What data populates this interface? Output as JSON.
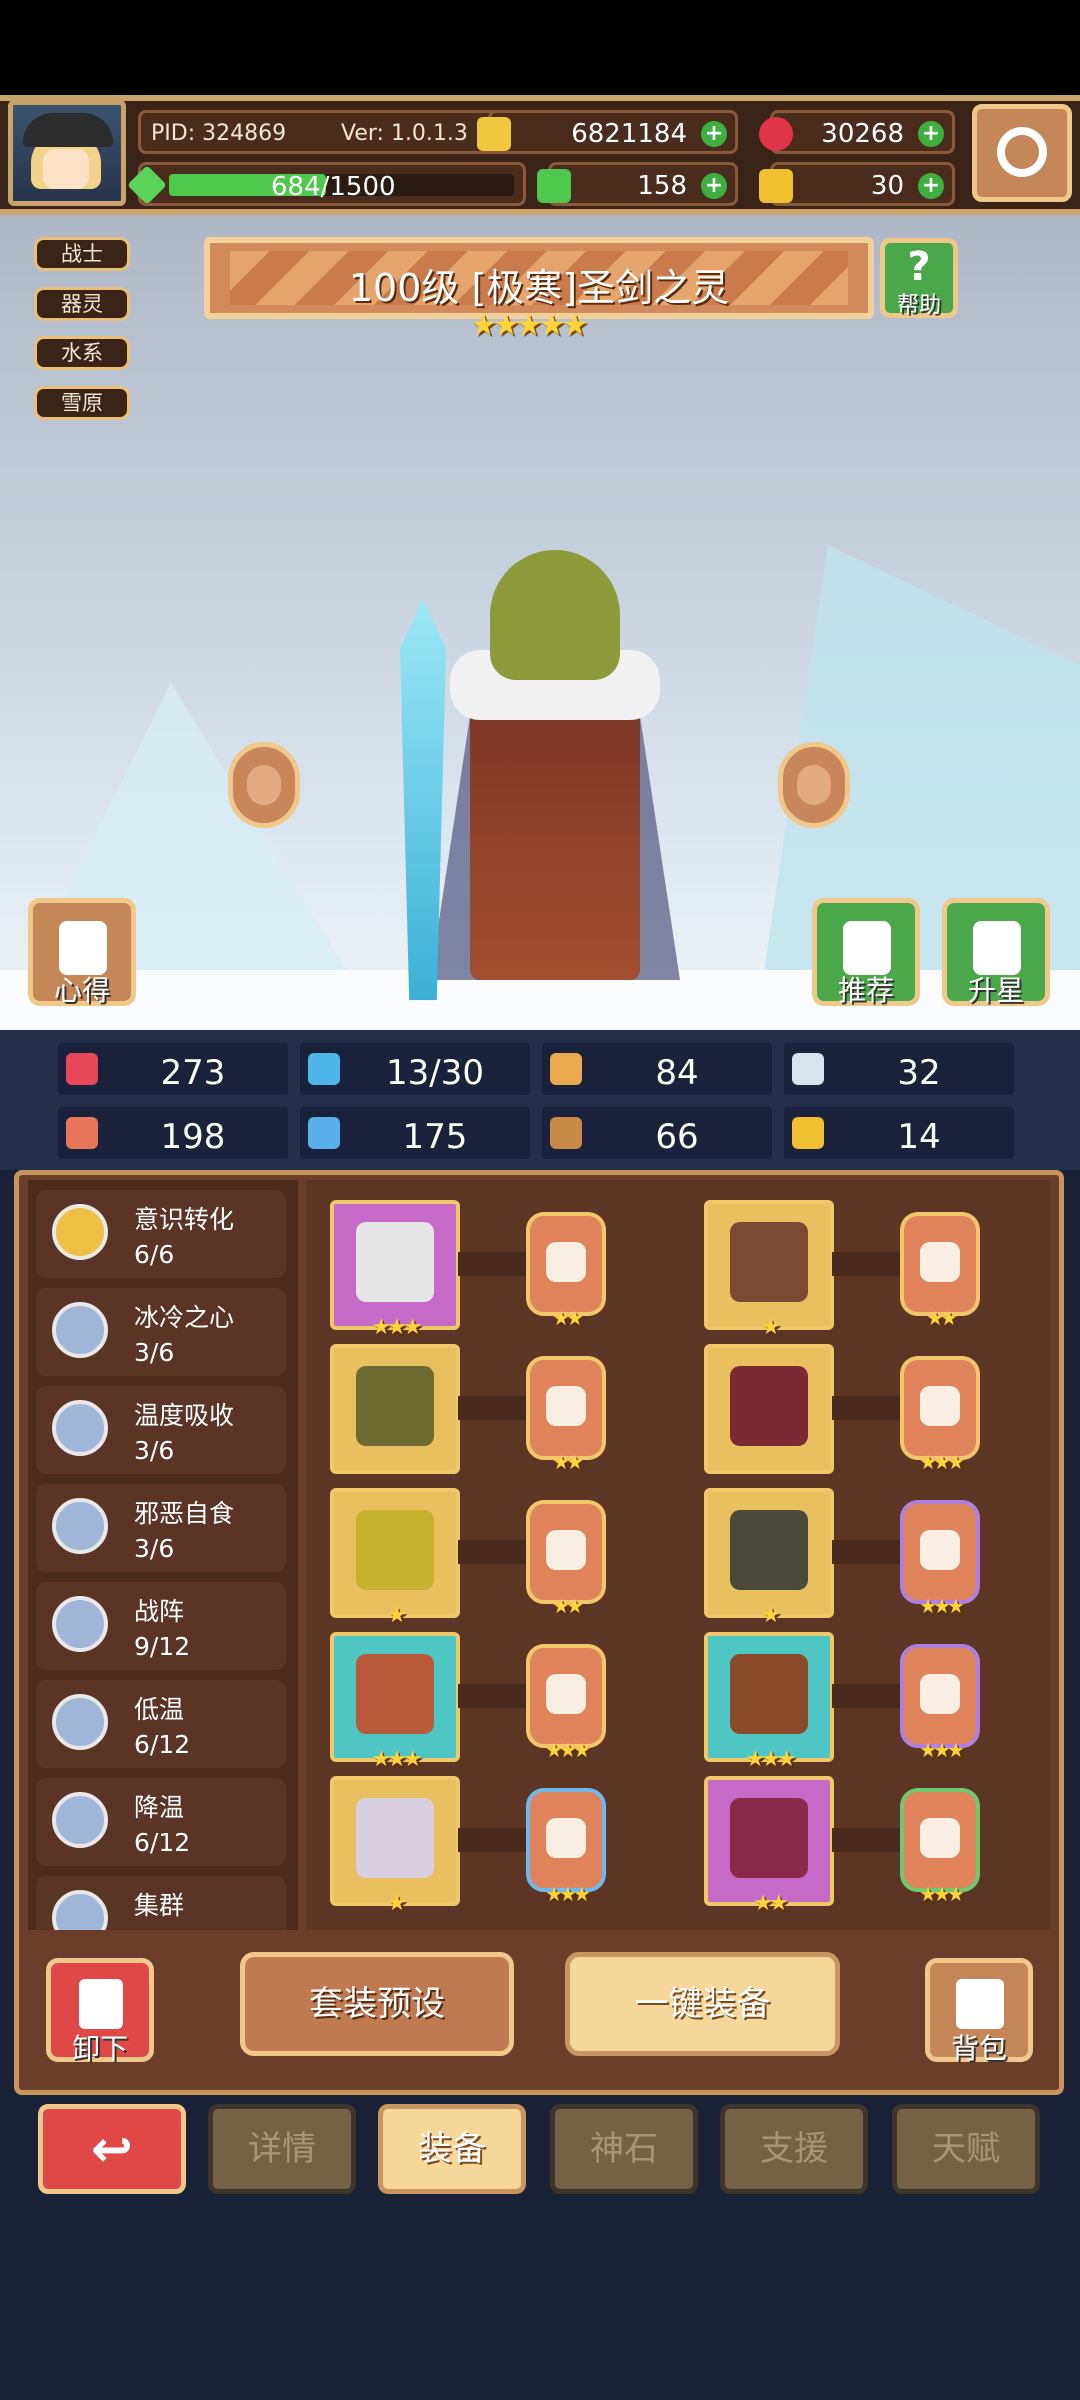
{
  "header": {
    "pid": "PID: 324869",
    "version": "Ver: 1.0.1.3",
    "exp_text": "684/1500",
    "exp_progress": 0.456,
    "resources": [
      {
        "icon": "gold-coin-icon",
        "value": "6821184"
      },
      {
        "icon": "red-gem-icon",
        "value": "30268"
      },
      {
        "icon": "clover-icon",
        "value": "158"
      },
      {
        "icon": "key-icon",
        "value": "30"
      }
    ],
    "plus_label": "+"
  },
  "hero": {
    "title": "100级 [极寒]圣剑之灵",
    "stars": "★★★★★",
    "tags": [
      "战士",
      "器灵",
      "水系",
      "雪原"
    ]
  },
  "buttons": {
    "help": "帮助",
    "notes": "心得",
    "recommend": "推荐",
    "star_up": "升星",
    "unequip": "卸下",
    "preset": "套装预设",
    "equip_all": "一键装备",
    "bag": "背包"
  },
  "stats": [
    {
      "icon": "heart-icon",
      "value": "273",
      "color": "#e8475a"
    },
    {
      "icon": "water-drop-icon",
      "value": "13/30",
      "color": "#4fb6e8"
    },
    {
      "icon": "shield-icon",
      "value": "84",
      "color": "#e8a94f"
    },
    {
      "icon": "wing-icon",
      "value": "32",
      "color": "#d9e2ee"
    },
    {
      "icon": "fist-icon",
      "value": "198",
      "color": "#e8755a"
    },
    {
      "icon": "book-icon",
      "value": "175",
      "color": "#5ab0e8"
    },
    {
      "icon": "boot-icon",
      "value": "66",
      "color": "#c88a48"
    },
    {
      "icon": "horseshoe-icon",
      "value": "14",
      "color": "#f0c030"
    }
  ],
  "skills": [
    {
      "name": "意识转化",
      "count": "6/6"
    },
    {
      "name": "冰冷之心",
      "count": "3/6"
    },
    {
      "name": "温度吸收",
      "count": "3/6"
    },
    {
      "name": "邪恶自食",
      "count": "3/6"
    },
    {
      "name": "战阵",
      "count": "9/12"
    },
    {
      "name": "低温",
      "count": "6/12"
    },
    {
      "name": "降温",
      "count": "6/12"
    },
    {
      "name": "集群",
      "count": ""
    }
  ],
  "equipment": [
    {
      "slot_stars": "★★★",
      "rune_stars": "★★"
    },
    {
      "slot_stars": "★",
      "rune_stars": "★★"
    },
    {
      "slot_stars": "",
      "rune_stars": "★★"
    },
    {
      "slot_stars": "",
      "rune_stars": "★★★"
    },
    {
      "slot_stars": "★",
      "rune_stars": "★★"
    },
    {
      "slot_stars": "★",
      "rune_stars": "★★★"
    },
    {
      "slot_stars": "★★★",
      "rune_stars": "★★★"
    },
    {
      "slot_stars": "★★★",
      "rune_stars": "★★★"
    },
    {
      "slot_stars": "★",
      "rune_stars": "★★★"
    },
    {
      "slot_stars": "★★",
      "rune_stars": "★★★"
    }
  ],
  "nav": {
    "back_icon": "back-arrow-icon",
    "back_glyph": "↩",
    "tabs": [
      "详情",
      "装备",
      "神石",
      "支援",
      "天赋"
    ],
    "active": "装备"
  }
}
